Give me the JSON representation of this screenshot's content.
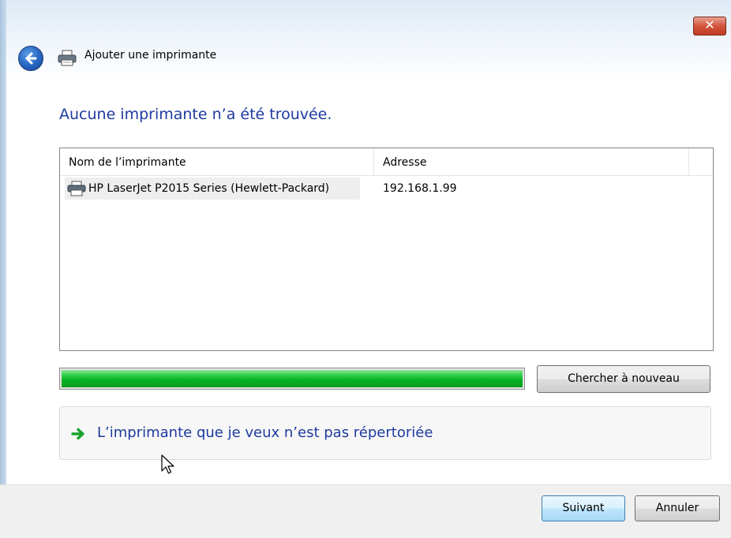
{
  "window": {
    "title": "Ajouter une imprimante",
    "close_label": "✕"
  },
  "heading": "Aucune imprimante n’a été trouvée.",
  "list": {
    "columns": [
      "Nom de l’imprimante",
      "Adresse"
    ],
    "rows": [
      {
        "name": "HP LaserJet P2015 Series (Hewlett-Packard)",
        "address": "192.168.1.99",
        "icon": "printer-icon"
      }
    ]
  },
  "progress": {
    "value": 1.0,
    "color": "#06b025"
  },
  "buttons": {
    "search_again": "Chercher à nouveau",
    "next": "Suivant",
    "cancel": "Annuler"
  },
  "link": {
    "label": "L’imprimante que je veux n’est pas répertoriée",
    "icon": "green-arrow-icon"
  },
  "colors": {
    "heading": "#1e3a9f",
    "link": "#1e3a9f",
    "close_button": "#c13a22"
  }
}
